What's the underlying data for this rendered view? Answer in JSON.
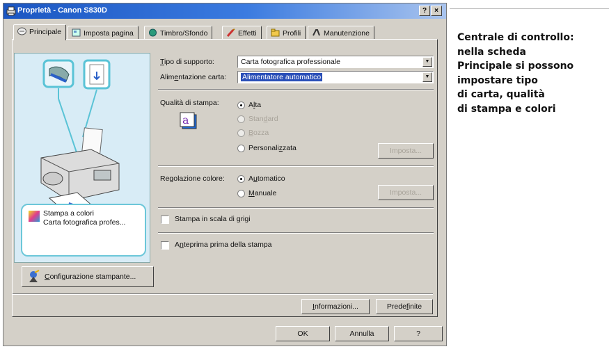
{
  "window": {
    "title": "Proprietà - Canon S830D",
    "help_btn": "?",
    "close_btn": "×"
  },
  "tabs": [
    {
      "label": "Principale",
      "icon": "page-icon"
    },
    {
      "label": "Imposta pagina",
      "icon": "layout-icon"
    },
    {
      "label": "Timbro/Sfondo",
      "icon": "stamp-icon"
    },
    {
      "label": "Effetti",
      "icon": "brush-icon"
    },
    {
      "label": "Profili",
      "icon": "folder-icon"
    },
    {
      "label": "Manutenzione",
      "icon": "tools-icon"
    }
  ],
  "media": {
    "label": "Tipo di supporto:",
    "value": "Carta fotografica professionale"
  },
  "feed": {
    "label": "Alimentazione carta:",
    "value": "Alimentatore automatico"
  },
  "quality": {
    "label": "Qualità di stampa:",
    "options": [
      "Alta",
      "Standard",
      "Bozza",
      "Personalizzata"
    ],
    "selected": "Alta",
    "set_button": "Imposta..."
  },
  "color": {
    "label": "Regolazione colore:",
    "options": [
      "Automatico",
      "Manuale"
    ],
    "selected": "Automatico",
    "set_button": "Imposta..."
  },
  "grayscale": {
    "label": "Stampa in scala di grigi",
    "checked": false
  },
  "preview_chk": {
    "label": "Anteprima prima della stampa",
    "checked": false
  },
  "preview_info": {
    "line1": "Stampa a colori",
    "line2": "Carta fotografica profes..."
  },
  "config_button": "Configurazione stampante...",
  "info_button": "Informazioni...",
  "defaults_button": "Predefinite",
  "dialog": {
    "ok": "OK",
    "cancel": "Annulla",
    "help": "?"
  },
  "caption_lines": [
    "Centrale di controllo:",
    "nella scheda",
    "Principale si possono",
    "impostare tipo",
    "di carta, qualità",
    "di stampa e colori"
  ]
}
